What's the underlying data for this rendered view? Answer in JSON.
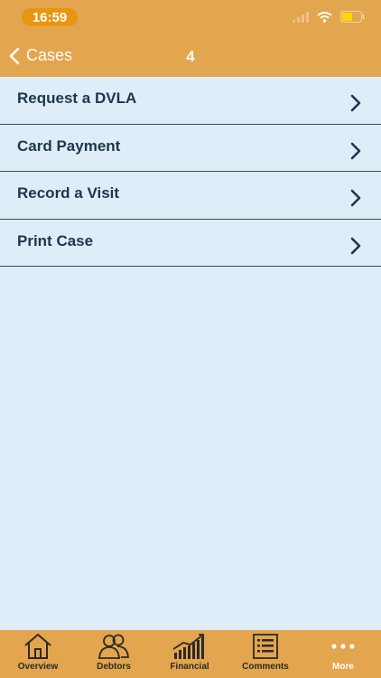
{
  "status": {
    "time": "16:59"
  },
  "nav": {
    "back_label": "Cases",
    "title": "4"
  },
  "menu": {
    "items": [
      {
        "label": "Request a DVLA"
      },
      {
        "label": "Card Payment"
      },
      {
        "label": "Record a Visit"
      },
      {
        "label": "Print Case"
      }
    ]
  },
  "tabs": [
    {
      "label": "Overview",
      "icon": "home-icon"
    },
    {
      "label": "Debtors",
      "icon": "people-icon"
    },
    {
      "label": "Financial",
      "icon": "chart-icon"
    },
    {
      "label": "Comments",
      "icon": "list-icon"
    },
    {
      "label": "More",
      "icon": "more-icon"
    }
  ],
  "colors": {
    "bar": "#e3a54d",
    "background": "#deedf7",
    "text_dark": "#1f3550"
  }
}
